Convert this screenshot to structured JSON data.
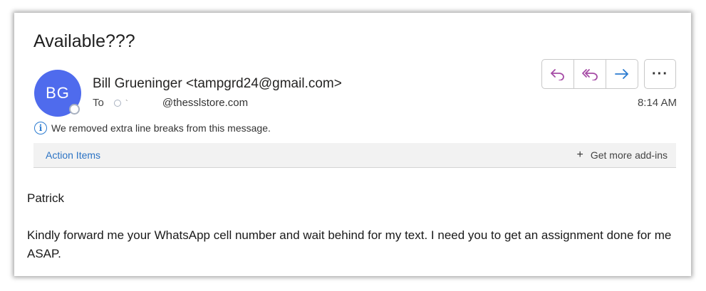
{
  "subject": "Available???",
  "sender": {
    "initials": "BG",
    "display": "Bill Grueninger <tampgrd24@gmail.com>",
    "avatar_color": "#4f6bed"
  },
  "recipient": {
    "label": "To",
    "tick": "`",
    "domain": "@thesslstore.com"
  },
  "time": "8:14 AM",
  "info": {
    "icon": "info-icon",
    "text": "We removed extra line breaks from this message."
  },
  "actions_bar": {
    "action_items": "Action Items",
    "addins_icon": "plus-icon",
    "addins_label": "Get more add-ins"
  },
  "buttons": {
    "reply": "reply-icon",
    "reply_all": "reply-all-icon",
    "forward": "forward-icon",
    "more": "···"
  },
  "body": {
    "greeting": "Patrick",
    "message": "Kindly forward me your WhatsApp cell number and wait behind for my text. I need you to get an assignment done for me ASAP."
  },
  "colors": {
    "reply": "#a64ca6",
    "forward": "#2b7bd0",
    "link": "#2b73c4"
  }
}
